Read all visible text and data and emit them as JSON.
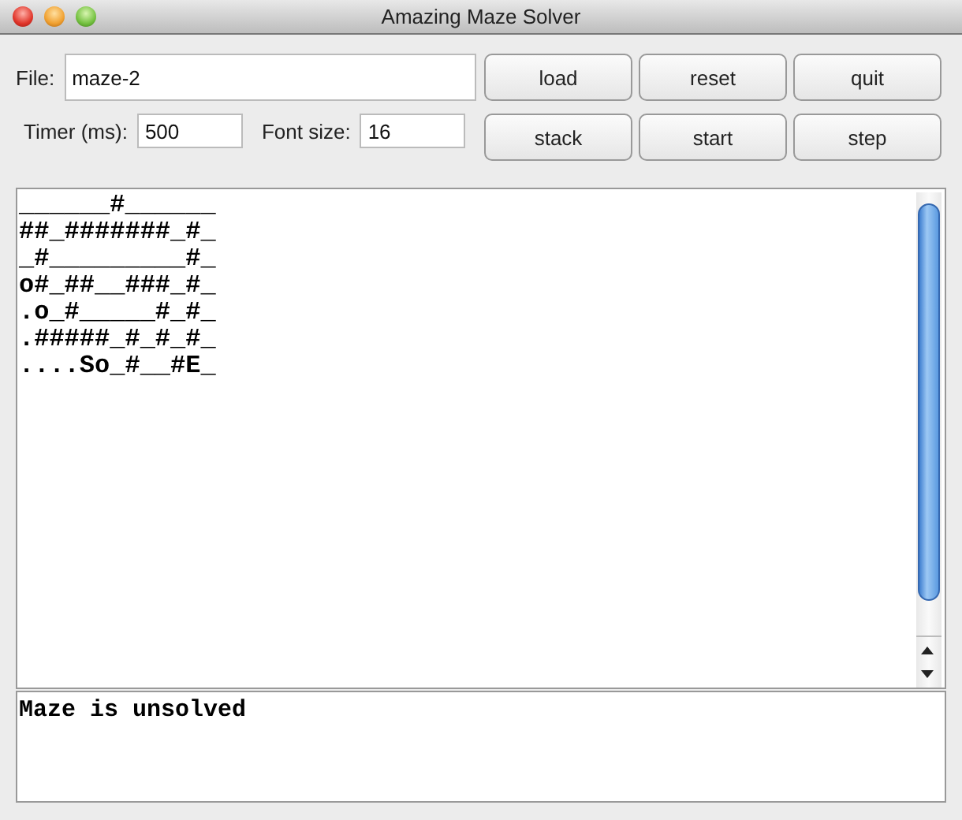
{
  "window": {
    "title": "Amazing Maze Solver"
  },
  "file_field": {
    "label": "File:",
    "value": "maze-2"
  },
  "timer_field": {
    "label": "Timer (ms):",
    "value": "500"
  },
  "font_size_field": {
    "label": "Font size:",
    "value": "16"
  },
  "buttons": [
    "load",
    "reset",
    "quit",
    "stack",
    "start",
    "step"
  ],
  "maze_lines": [
    "______#______",
    "##_#######_#_",
    "_#_________#_",
    "o#_##__###_#_",
    ".o_#_____#_#_",
    ".#####_#_#_#_",
    "....So_#__#E_"
  ],
  "status": "Maze is unsolved"
}
